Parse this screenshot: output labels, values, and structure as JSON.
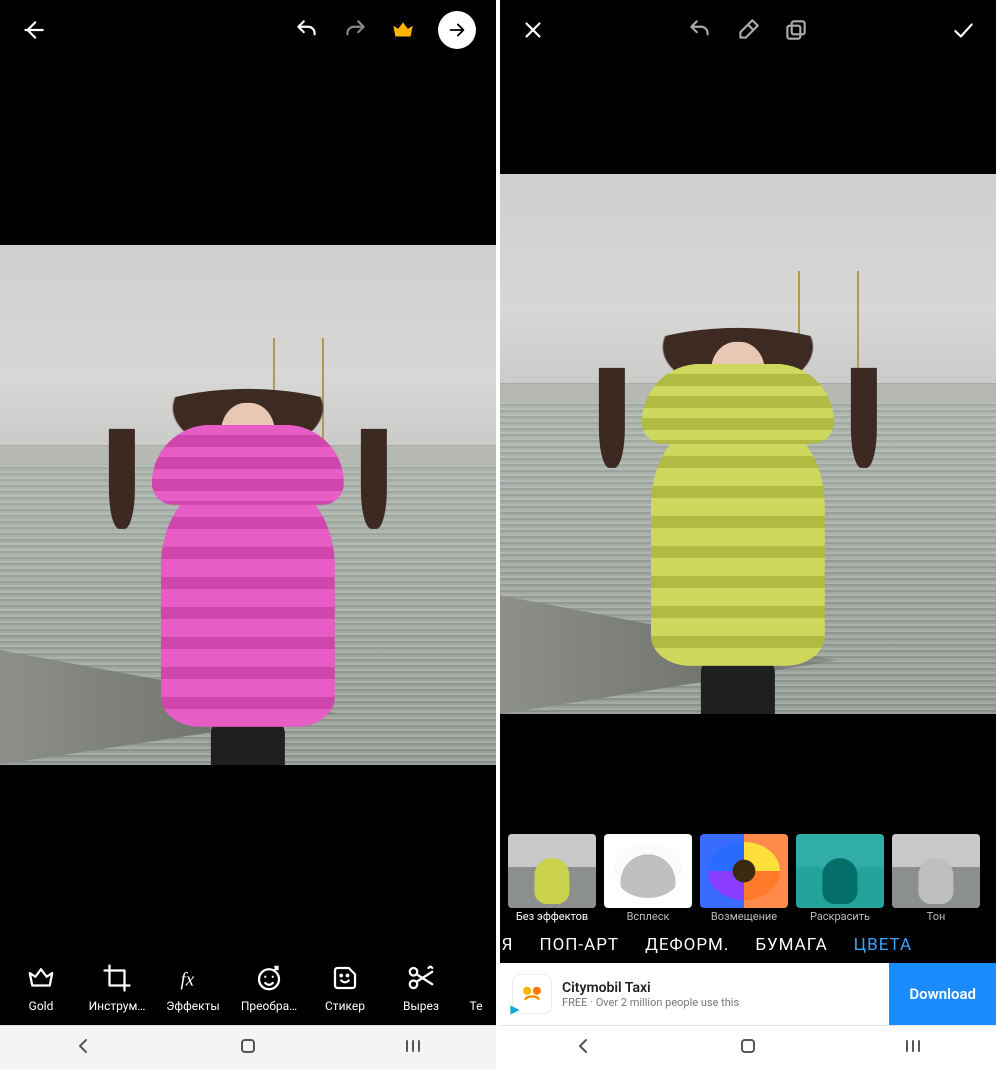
{
  "left": {
    "toolbar": {
      "tools": [
        {
          "id": "gold",
          "label": "Gold"
        },
        {
          "id": "tools",
          "label": "Инструм…"
        },
        {
          "id": "effects",
          "label": "Эффекты"
        },
        {
          "id": "transform",
          "label": "Преобра…"
        },
        {
          "id": "sticker",
          "label": "Стикер"
        },
        {
          "id": "cutout",
          "label": "Вырез"
        },
        {
          "id": "text",
          "label": "Те"
        }
      ]
    },
    "photo_coat_color": "pink"
  },
  "right": {
    "thumbs": [
      {
        "id": "none",
        "label": "Без эффектов",
        "active": true,
        "variant": "effect-none"
      },
      {
        "id": "splash",
        "label": "Всплеск",
        "active": false,
        "variant": "effect-splash"
      },
      {
        "id": "replace",
        "label": "Возмещение",
        "active": false,
        "variant": "effect-replace"
      },
      {
        "id": "colorize",
        "label": "Раскрасить",
        "active": false,
        "variant": "effect-colorize"
      },
      {
        "id": "tone",
        "label": "Тон",
        "active": false,
        "variant": "effect-tone"
      }
    ],
    "categories": [
      {
        "id": "partial",
        "label": "IЯ",
        "active": false,
        "partial": true
      },
      {
        "id": "popart",
        "label": "ПОП-АРТ",
        "active": false
      },
      {
        "id": "deform",
        "label": "ДЕФОРМ.",
        "active": false
      },
      {
        "id": "paper",
        "label": "БУМАГА",
        "active": false
      },
      {
        "id": "colors",
        "label": "ЦВЕТА",
        "active": true
      }
    ],
    "ad": {
      "title": "Citymobil Taxi",
      "subtitle": "FREE · Over 2 million people use this",
      "cta": "Download"
    },
    "photo_coat_color": "lime"
  }
}
